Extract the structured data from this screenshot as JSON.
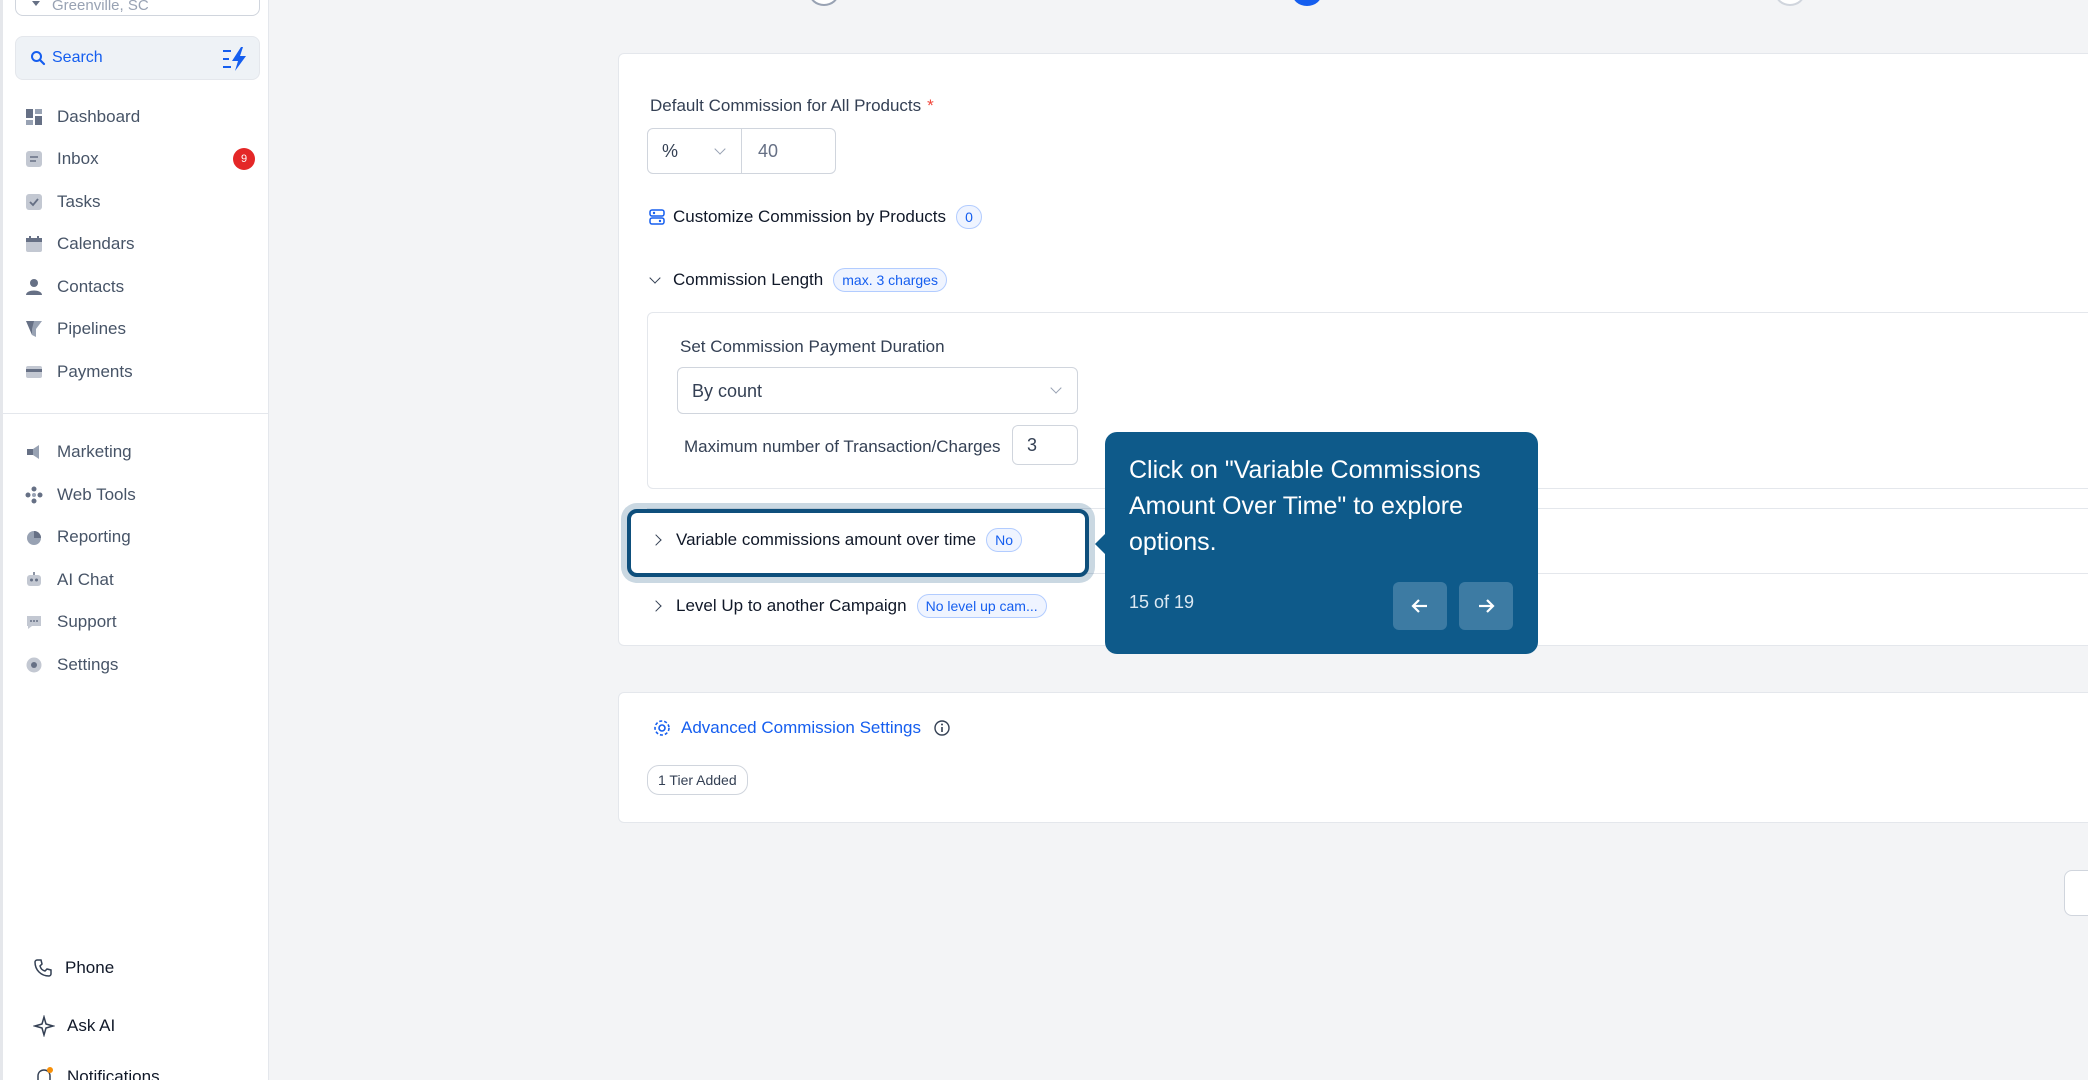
{
  "sidebar": {
    "location": "Greenville, SC",
    "search_label": "Search",
    "items": [
      {
        "label": "Dashboard",
        "icon": "dashboard-icon"
      },
      {
        "label": "Inbox",
        "icon": "inbox-icon",
        "badge": "9"
      },
      {
        "label": "Tasks",
        "icon": "tasks-icon"
      },
      {
        "label": "Calendars",
        "icon": "calendar-icon"
      },
      {
        "label": "Contacts",
        "icon": "contacts-icon"
      },
      {
        "label": "Pipelines",
        "icon": "pipelines-icon"
      },
      {
        "label": "Payments",
        "icon": "payments-icon"
      },
      {
        "label": "Marketing",
        "icon": "marketing-icon"
      },
      {
        "label": "Web Tools",
        "icon": "web-tools-icon"
      },
      {
        "label": "Reporting",
        "icon": "reporting-icon"
      },
      {
        "label": "AI Chat",
        "icon": "ai-chat-icon"
      },
      {
        "label": "Support",
        "icon": "support-icon"
      },
      {
        "label": "Settings",
        "icon": "settings-icon"
      }
    ],
    "bottom": {
      "phone": "Phone",
      "ask_ai": "Ask AI",
      "notifications": "Notifications"
    }
  },
  "commission": {
    "default_label": "Default Commission for All Products",
    "required_mark": "*",
    "unit": "%",
    "value": "40",
    "customize_label": "Customize Commission by Products",
    "customize_count": "0",
    "length_label": "Commission Length",
    "length_pill": "max. 3 charges",
    "duration_label": "Set Commission Payment Duration",
    "duration_value": "By count",
    "max_label": "Maximum number of Transaction/Charges",
    "max_value": "3",
    "variable_label": "Variable commissions amount over time",
    "variable_pill": "No",
    "levelup_label": "Level Up to another Campaign",
    "levelup_pill": "No level up cam..."
  },
  "advanced": {
    "label": "Advanced Commission Settings",
    "tier_badge": "1 Tier Added"
  },
  "tooltip": {
    "text": "Click on \"Variable Commissions Amount Over Time\" to explore options.",
    "progress": "15 of 19"
  },
  "colors": {
    "accent": "#155eef",
    "tooltip_bg": "#0e5a8a",
    "badge_red": "#e42727"
  }
}
